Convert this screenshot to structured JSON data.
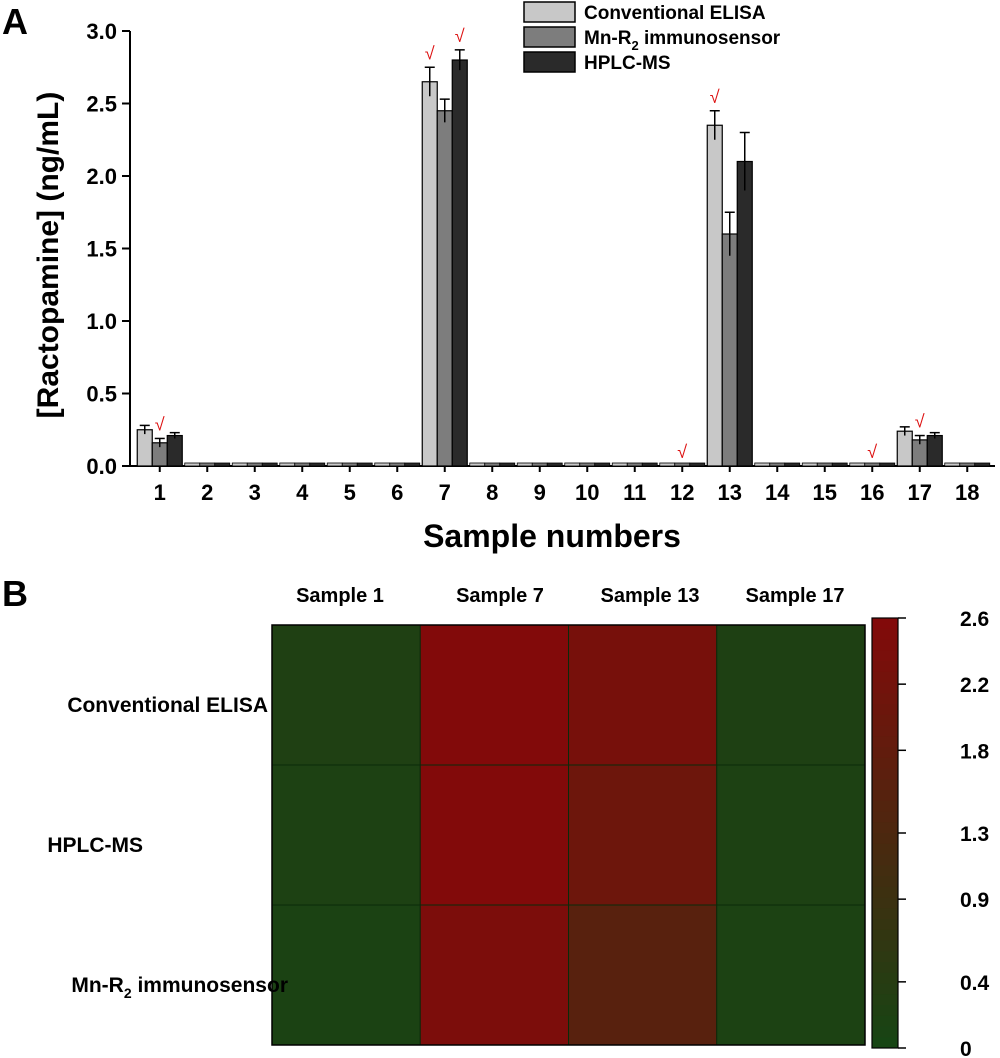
{
  "panel_a": {
    "label": "A",
    "xlabel": "Sample numbers",
    "ylabel": "[Ractopamine] (ng/mL)",
    "legend": [
      "Conventional ELISA",
      "Mn-R",
      "2",
      " immunosensor",
      "HPLC-MS"
    ],
    "check_mark": "√"
  },
  "panel_b": {
    "label": "B",
    "columns": [
      "Sample 1",
      "Sample 7",
      "Sample 13",
      "Sample 17"
    ],
    "rows": [
      "Conventional ELISA",
      "HPLC-MS",
      "Mn-R",
      "2",
      " immunosensor"
    ],
    "colorbar_ticks": [
      "2.6",
      "2.2",
      "1.8",
      "1.3",
      "0.9",
      "0.4",
      "0"
    ]
  },
  "colors": {
    "elisa": "#c8c8c8",
    "immunosensor": "#7d7d7d",
    "hplc": "#2a2a2a",
    "check": "#dd1111"
  },
  "chart_data": [
    {
      "type": "bar",
      "title": "",
      "xlabel": "Sample numbers",
      "ylabel": "[Ractopamine] (ng/mL)",
      "ylim": [
        0,
        3.0
      ],
      "yticks": [
        "0.0",
        "0.5",
        "1.0",
        "1.5",
        "2.0",
        "2.5",
        "3.0"
      ],
      "categories": [
        "1",
        "2",
        "3",
        "4",
        "5",
        "6",
        "7",
        "8",
        "9",
        "10",
        "11",
        "12",
        "13",
        "14",
        "15",
        "16",
        "17",
        "18"
      ],
      "series": [
        {
          "name": "Conventional ELISA",
          "values": [
            0.25,
            0,
            0,
            0,
            0,
            0,
            2.65,
            0,
            0,
            0,
            0,
            0,
            2.35,
            0,
            0,
            0,
            0.24,
            0
          ]
        },
        {
          "name": "Mn-R2 immunosensor",
          "values": [
            0.16,
            0,
            0,
            0,
            0,
            0,
            2.45,
            0,
            0,
            0,
            0,
            0,
            1.6,
            0,
            0,
            0,
            0.18,
            0
          ]
        },
        {
          "name": "HPLC-MS",
          "values": [
            0.21,
            0,
            0,
            0,
            0,
            0,
            2.8,
            0,
            0,
            0,
            0,
            0,
            2.1,
            0,
            0,
            0,
            0.21,
            0
          ]
        }
      ],
      "errors": [
        [
          0.03,
          0,
          0,
          0,
          0,
          0,
          0.1,
          0,
          0,
          0,
          0,
          0,
          0.1,
          0,
          0,
          0,
          0.03,
          0
        ],
        [
          0.03,
          0,
          0,
          0,
          0,
          0,
          0.08,
          0,
          0,
          0,
          0,
          0,
          0.15,
          0,
          0,
          0,
          0.03,
          0
        ],
        [
          0.02,
          0,
          0,
          0,
          0,
          0,
          0.07,
          0,
          0,
          0,
          0,
          0,
          0.2,
          0,
          0,
          0,
          0.02,
          0
        ]
      ],
      "check_marks": [
        {
          "category": "1",
          "series": "Mn-R2 immunosensor"
        },
        {
          "category": "7",
          "series": "Conventional ELISA"
        },
        {
          "category": "7",
          "series": "HPLC-MS"
        },
        {
          "category": "12",
          "series": "Mn-R2 immunosensor"
        },
        {
          "category": "13",
          "series": "Conventional ELISA"
        },
        {
          "category": "16",
          "series": "Mn-R2 immunosensor"
        },
        {
          "category": "17",
          "series": "Mn-R2 immunosensor"
        }
      ],
      "legend_position": "top-right",
      "grid": false
    },
    {
      "type": "heatmap",
      "x": [
        "Sample 1",
        "Sample 7",
        "Sample 13",
        "Sample 17"
      ],
      "y": [
        "Conventional ELISA",
        "HPLC-MS",
        "Mn-R2 immunosensor"
      ],
      "values": [
        [
          0.25,
          2.65,
          2.35,
          0.24
        ],
        [
          0.21,
          2.8,
          2.1,
          0.21
        ],
        [
          0.16,
          2.45,
          1.6,
          0.18
        ]
      ],
      "colorbar_range": [
        0,
        2.6
      ]
    }
  ]
}
